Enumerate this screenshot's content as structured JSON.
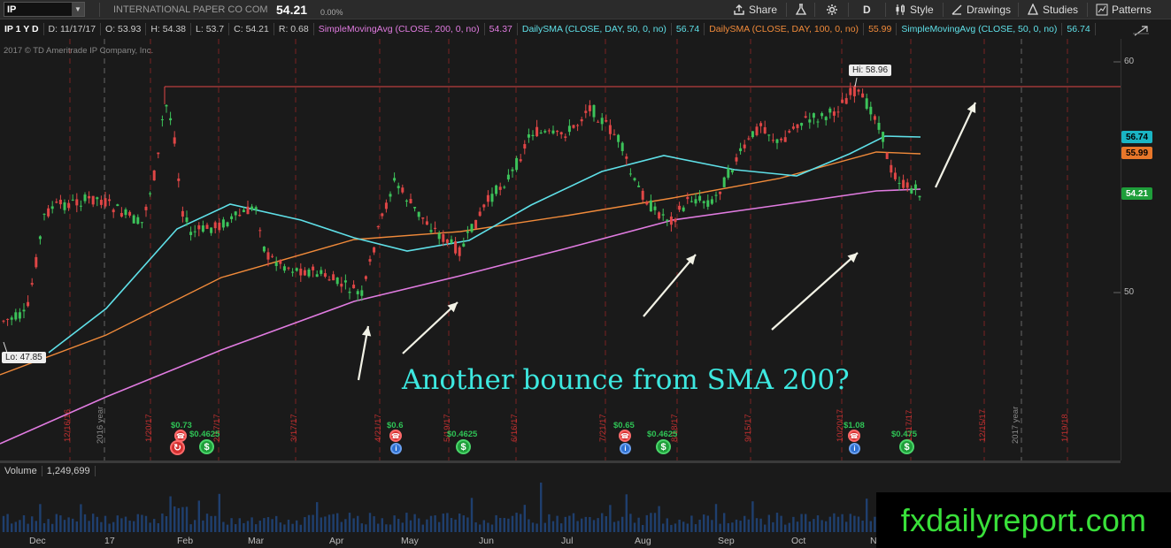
{
  "toolbar": {
    "symbol": "IP",
    "company": "INTERNATIONAL PAPER CO COM",
    "last_price": "54.21",
    "pct_change": "0.00%",
    "share_label": "Share",
    "aggregation_label": "D",
    "style_label": "Style",
    "drawings_label": "Drawings",
    "studies_label": "Studies",
    "patterns_label": "Patterns"
  },
  "infobar": {
    "symbol_period": "IP 1 Y D",
    "date": "D: 11/17/17",
    "open": "O: 53.93",
    "high": "H: 54.38",
    "low": "L: 53.7",
    "close": "C: 54.21",
    "range": "R: 0.68",
    "sma200_label": "SimpleMovingAvg (CLOSE, 200, 0, no)",
    "sma200_value": "54.37",
    "sma50_label": "DailySMA (CLOSE, DAY, 50, 0, no)",
    "sma50_value": "56.74",
    "sma100_label": "DailySMA (CLOSE, DAY, 100, 0, no)",
    "sma100_value": "55.99",
    "sma50b_label": "SimpleMovingAvg (CLOSE, 50, 0, no)",
    "sma50b_value": "56.74"
  },
  "copyright": "2017 © TD Ameritrade IP Company, Inc.",
  "price_axis": {
    "labels": [
      "60",
      "50"
    ],
    "tags": {
      "sma50": "56.74",
      "sma100": "55.99",
      "last": "54.21"
    }
  },
  "markers": {
    "high": "Hi: 58.96",
    "low": "Lo: 47.85"
  },
  "annotation": "Another bounce from SMA 200?",
  "volume": {
    "label": "Volume",
    "value": "1,249,699"
  },
  "time_axis": [
    "Dec",
    "17",
    "Feb",
    "Mar",
    "Apr",
    "May",
    "Jun",
    "Jul",
    "Aug",
    "Sep",
    "Oct",
    "N"
  ],
  "date_markers": [
    "12/16/16",
    "1/20/17",
    "2/17/17",
    "3/17/17",
    "4/21/17",
    "5/19/17",
    "6/16/17",
    "7/21/17",
    "8/18/17",
    "9/15/17",
    "10/20/17",
    "11/17/17",
    "12/15/17",
    "1/19/18"
  ],
  "year_markers": [
    "2016 year",
    "2017 year"
  ],
  "dividends": [
    "$0.73",
    "$0.4625",
    "$0.6",
    "$0.4625",
    "$0.65",
    "$0.4625",
    "$1.08",
    "$0.475"
  ],
  "watermark": "fxdailyreport.com",
  "colors": {
    "sma50": "#5fe0e8",
    "sma100": "#f08a3a",
    "sma200": "#e07be0",
    "up_candle": "#3cc35a",
    "down_candle": "#e04646",
    "annotation": "#3de8e0",
    "watermark": "#39e03a"
  },
  "chart_data": {
    "type": "candlestick",
    "title": "",
    "y_axis_ticks": [
      50,
      60
    ],
    "high": 58.96,
    "low": 47.85,
    "last_close": 54.21,
    "series": [
      {
        "name": "SimpleMovingAvg (CLOSE, 200, 0, no)",
        "last": 54.37
      },
      {
        "name": "DailySMA (CLOSE, DAY, 50, 0, no)",
        "last": 56.74
      },
      {
        "name": "DailySMA (CLOSE, DAY, 100, 0, no)",
        "last": 55.99
      }
    ]
  }
}
